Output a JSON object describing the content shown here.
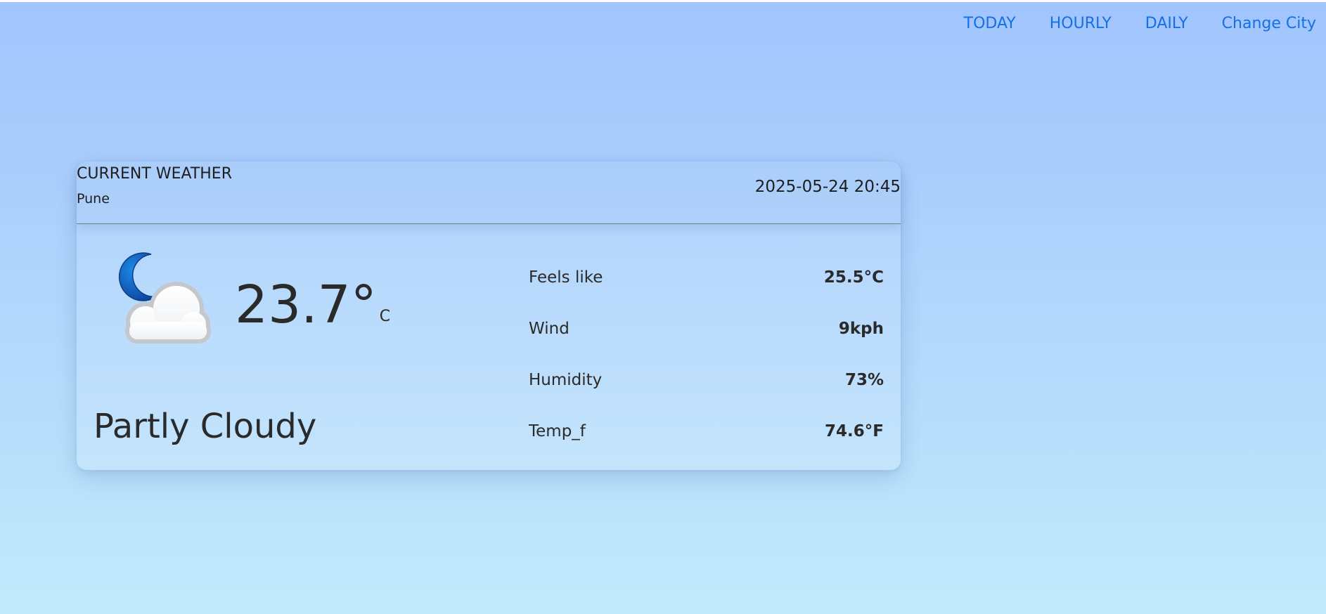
{
  "nav": {
    "items": [
      {
        "label": "TODAY"
      },
      {
        "label": "HOURLY"
      },
      {
        "label": "DAILY"
      },
      {
        "label": "Change City"
      }
    ],
    "link_color": "#1570e6"
  },
  "weather": {
    "header_title": "CURRENT WEATHER",
    "city": "Pune",
    "datetime": "2025-05-24 20:45",
    "icon": "moon-cloud-icon",
    "temperature": "23.7°",
    "temperature_unit": "C",
    "condition": "Partly Cloudy",
    "details": [
      {
        "label": "Feels like",
        "value": "25.5°C"
      },
      {
        "label": "Wind",
        "value": "9kph"
      },
      {
        "label": "Humidity",
        "value": "73%"
      },
      {
        "label": "Temp_f",
        "value": "74.6°F"
      }
    ]
  },
  "colors": {
    "background_top": "#a1c4fd",
    "background_bottom": "#c2e9fb",
    "moon": "#1565c0"
  }
}
